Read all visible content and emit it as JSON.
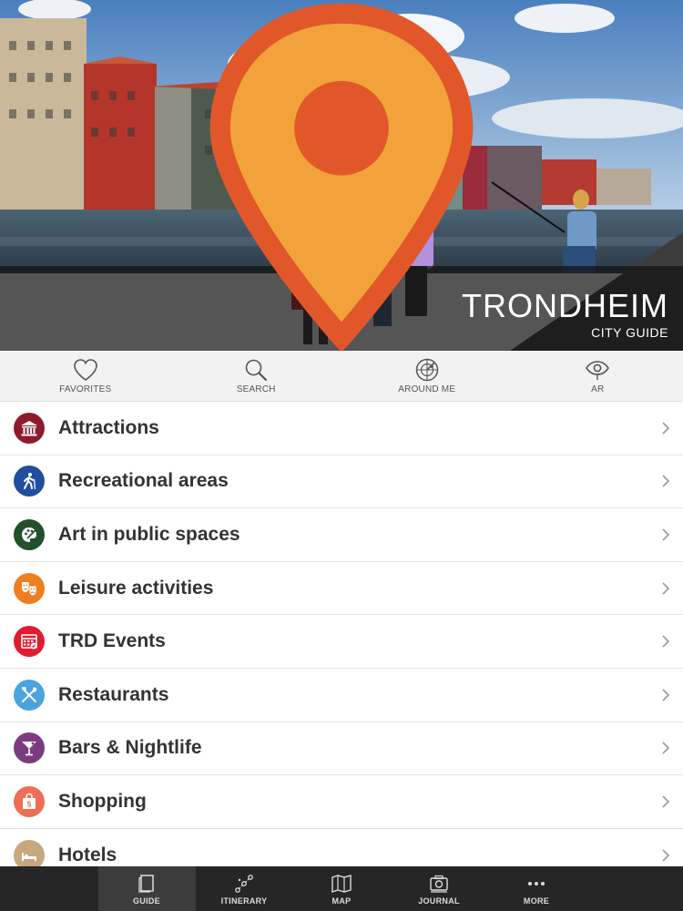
{
  "brand": {
    "title": "TRONDHEIM",
    "subtitle": "CITY GUIDE"
  },
  "quickbar": [
    {
      "label": "FAVORITES",
      "icon": "heart-icon"
    },
    {
      "label": "SEARCH",
      "icon": "search-icon"
    },
    {
      "label": "AROUND ME",
      "icon": "radar-icon"
    },
    {
      "label": "AR",
      "icon": "eye-icon"
    }
  ],
  "categories": [
    {
      "label": "Attractions",
      "icon": "museum-icon",
      "color": "#8e1b2c"
    },
    {
      "label": "Recreational areas",
      "icon": "hiker-icon",
      "color": "#1f4e9e"
    },
    {
      "label": "Art in public spaces",
      "icon": "palette-icon",
      "color": "#23502a"
    },
    {
      "label": "Leisure activities",
      "icon": "theater-masks-icon",
      "color": "#f07d1f"
    },
    {
      "label": "TRD Events",
      "icon": "calendar-icon",
      "color": "#e21b2e"
    },
    {
      "label": "Restaurants",
      "icon": "cutlery-icon",
      "color": "#4aa3dc"
    },
    {
      "label": "Bars & Nightlife",
      "icon": "cocktail-icon",
      "color": "#7b3b7e"
    },
    {
      "label": "Shopping",
      "icon": "shopping-bag-icon",
      "color": "#ee6d55"
    },
    {
      "label": "Hotels",
      "icon": "bed-icon",
      "color": "#c6a77e"
    }
  ],
  "tabs": [
    {
      "label": "GUIDE",
      "icon": "book-icon",
      "active": true
    },
    {
      "label": "ITINERARY",
      "icon": "route-icon",
      "active": false
    },
    {
      "label": "MAP",
      "icon": "map-icon",
      "active": false
    },
    {
      "label": "JOURNAL",
      "icon": "camera-icon",
      "active": false
    },
    {
      "label": "MORE",
      "icon": "more-dots-icon",
      "active": false
    }
  ]
}
